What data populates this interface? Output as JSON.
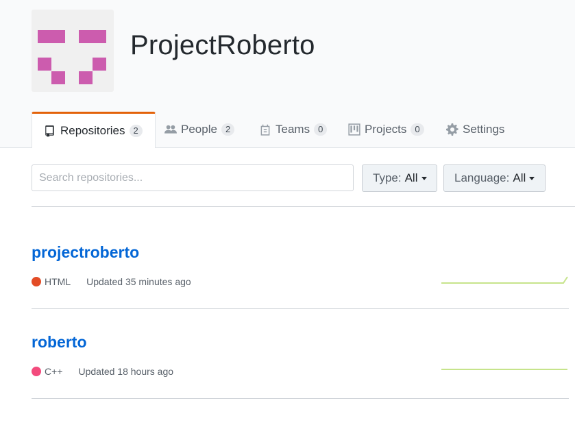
{
  "org": {
    "name": "ProjectRoberto"
  },
  "tabs": [
    {
      "label": "Repositories",
      "count": "2",
      "icon": "repo-icon",
      "selected": true
    },
    {
      "label": "People",
      "count": "2",
      "icon": "people-icon"
    },
    {
      "label": "Teams",
      "count": "0",
      "icon": "teams-icon"
    },
    {
      "label": "Projects",
      "count": "0",
      "icon": "project-icon"
    },
    {
      "label": "Settings",
      "icon": "gear-icon"
    }
  ],
  "filters": {
    "search_placeholder": "Search repositories...",
    "type_label": "Type:",
    "type_value": "All",
    "language_label": "Language:",
    "language_value": "All"
  },
  "repos": [
    {
      "name": "projectroberto",
      "language": "HTML",
      "language_color": "#e34c26",
      "updated": "Updated 35 minutes ago"
    },
    {
      "name": "roberto",
      "language": "C++",
      "language_color": "#f34b7d",
      "updated": "Updated 18 hours ago"
    }
  ],
  "colors": {
    "accent": "#e36209",
    "link": "#0366d6",
    "sparkline": "#c6e48b",
    "avatar": "#cc5cae"
  }
}
